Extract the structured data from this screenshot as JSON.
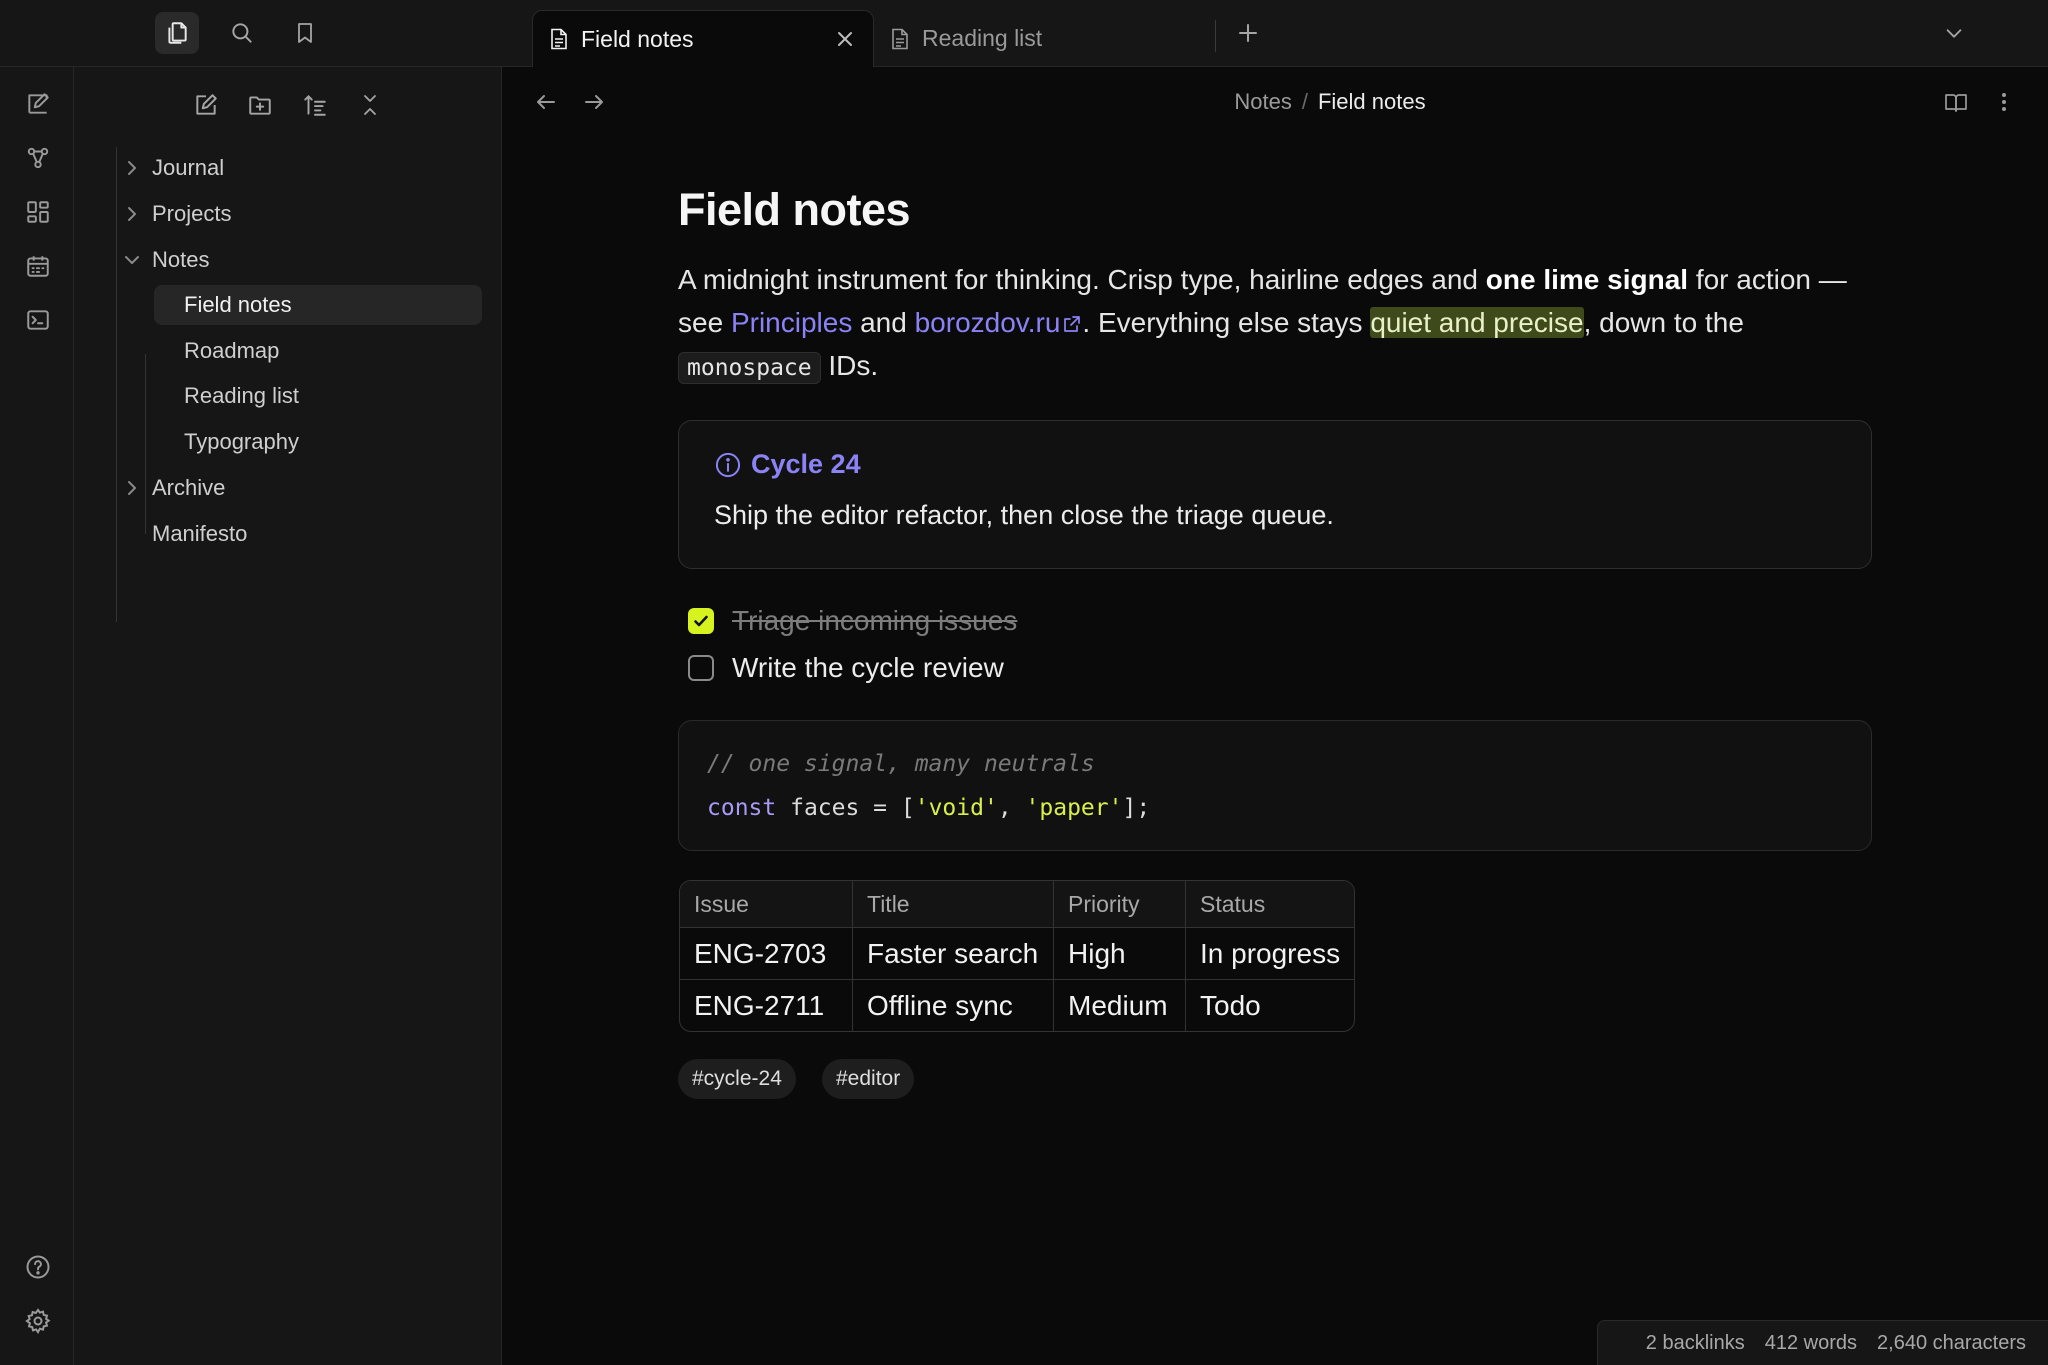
{
  "tabs": [
    {
      "title": "Field notes",
      "active": true
    },
    {
      "title": "Reading list",
      "active": false
    }
  ],
  "breadcrumb": {
    "parent": "Notes",
    "separator": "/",
    "current": "Field notes"
  },
  "file_tree": {
    "items": [
      {
        "label": "Journal",
        "type": "folder",
        "expanded": false
      },
      {
        "label": "Projects",
        "type": "folder",
        "expanded": false
      },
      {
        "label": "Notes",
        "type": "folder",
        "expanded": true
      },
      {
        "label": "Field notes",
        "type": "file",
        "selected": true
      },
      {
        "label": "Roadmap",
        "type": "file"
      },
      {
        "label": "Reading list",
        "type": "file"
      },
      {
        "label": "Typography",
        "type": "file"
      },
      {
        "label": "Archive",
        "type": "folder",
        "expanded": false
      },
      {
        "label": "Manifesto",
        "type": "file"
      }
    ]
  },
  "document": {
    "title": "Field notes",
    "intro": {
      "t1": "A midnight instrument for thinking. Crisp type, hairline edges and ",
      "bold": "one lime signal",
      "t2": " for action — see ",
      "link1": "Principles",
      "t3": " and ",
      "link2": "borozdov.ru",
      "t4": ". Everything else stays ",
      "highlight": "quiet and precise",
      "t5": ", down to the ",
      "code": "monospace",
      "t6": " IDs."
    },
    "callout": {
      "title": "Cycle 24",
      "body": "Ship the editor refactor, then close the triage queue."
    },
    "tasks": [
      {
        "text": "Triage incoming issues",
        "done": true
      },
      {
        "text": "Write the cycle review",
        "done": false
      }
    ],
    "code": {
      "comment": "// one signal, many neutrals",
      "keyword": "const",
      "ident": " faces = [",
      "str1": "'void'",
      "comma": ", ",
      "str2": "'paper'",
      "end": "];"
    },
    "table": {
      "headers": [
        "Issue",
        "Title",
        "Priority",
        "Status"
      ],
      "rows": [
        [
          "ENG-2703",
          "Faster search",
          "High",
          "In progress"
        ],
        [
          "ENG-2711",
          "Offline sync",
          "Medium",
          "Todo"
        ]
      ]
    },
    "tags": [
      "#cycle-24",
      "#editor"
    ]
  },
  "status_bar": {
    "backlinks": "2 backlinks",
    "words": "412 words",
    "characters": "2,640 characters"
  },
  "colors": {
    "accent": "#d6f21f",
    "link": "#8b83f5",
    "background": "#0a0a0a",
    "sidebar": "#161616"
  }
}
